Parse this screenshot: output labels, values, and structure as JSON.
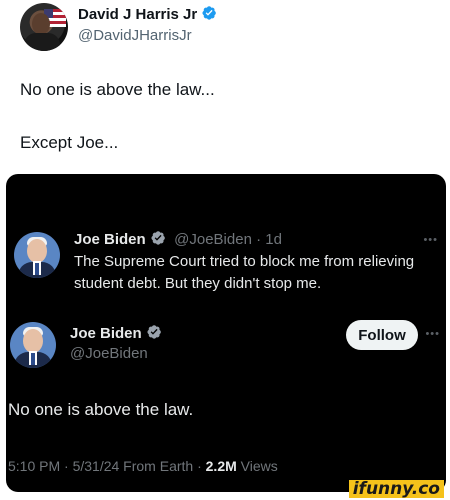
{
  "outer_tweet": {
    "author_name": "David J Harris Jr",
    "author_handle": "@DavidJHarrisJr",
    "line1": "No one is above the law...",
    "line2": "Except Joe..."
  },
  "quoted_screenshot": {
    "reply_tweet": {
      "author_name": "Joe Biden",
      "author_handle": "@JoeBiden",
      "time_ago": "1d",
      "text": "The Supreme Court tried to block me from relieving student debt. But they didn't stop me."
    },
    "main_tweet": {
      "author_name": "Joe Biden",
      "author_handle": "@JoeBiden",
      "follow_label": "Follow",
      "text": "No one is above the law.",
      "meta_prefix": "5:10 PM · 5/31/24 From Earth · ",
      "views_count": "2.2M",
      "views_label": " Views"
    }
  },
  "watermark_text": "ifunny.co",
  "colors": {
    "verified_blue": "#1d9bf0",
    "dark_background": "#000000",
    "watermark_yellow": "#f5c21b"
  },
  "icons": {
    "verified": "verified-badge-icon",
    "more": "more-options-icon"
  }
}
